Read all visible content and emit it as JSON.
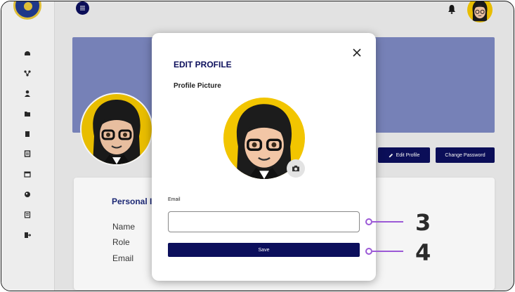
{
  "topbar": {
    "menu_icon": "hamburger-icon",
    "bell_icon": "bell-icon"
  },
  "sidebar": {
    "icons": [
      "dashboard-icon",
      "network-icon",
      "user-icon",
      "folder-icon",
      "document-icon",
      "book-icon",
      "calendar-icon",
      "gallery-icon",
      "list-icon",
      "logout-icon"
    ]
  },
  "profile": {
    "edit_profile_label": "Edit Profile",
    "change_password_label": "Change Password"
  },
  "card": {
    "title": "Personal In",
    "fields": [
      "Name",
      "Role",
      "Email"
    ]
  },
  "modal": {
    "title": "EDIT PROFILE",
    "picture_label": "Profile Picture",
    "email_label": "Email",
    "email_value": "",
    "email_placeholder": "",
    "save_label": "Save"
  },
  "callouts": [
    "3",
    "4"
  ],
  "colors": {
    "primary": "#0c0f5c",
    "banner": "#7b87bf",
    "accent": "#9b59d6",
    "avatar_bg": "#f2c500"
  }
}
